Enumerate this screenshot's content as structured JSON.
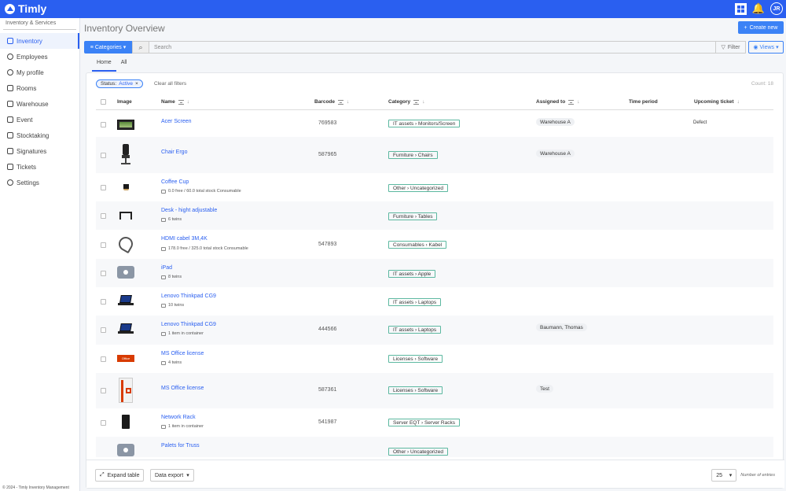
{
  "app": {
    "name": "Timly"
  },
  "header": {
    "avatar_initials": "JR"
  },
  "sidebar": {
    "section": "Inventory & Services",
    "items": [
      {
        "label": "Inventory"
      },
      {
        "label": "Employees"
      },
      {
        "label": "My profile"
      },
      {
        "label": "Rooms"
      },
      {
        "label": "Warehouse"
      },
      {
        "label": "Event"
      },
      {
        "label": "Stocktaking"
      },
      {
        "label": "Signatures"
      },
      {
        "label": "Tickets"
      },
      {
        "label": "Settings"
      }
    ],
    "footer": "© 2024 - Timly Inventory Management"
  },
  "page": {
    "title": "Inventory Overview",
    "create_label": "Create new"
  },
  "toolbar": {
    "categories": "Categories",
    "search_placeholder": "Search",
    "filter": "Filter",
    "views": "Views"
  },
  "tabs": [
    {
      "label": "Home"
    },
    {
      "label": "All"
    }
  ],
  "filters": {
    "status_label": "Status:",
    "status_value": "Active",
    "clear": "Clear all filters",
    "count": "Count: 18"
  },
  "columns": {
    "image": "Image",
    "name": "Name",
    "barcode": "Barcode",
    "category": "Category",
    "assigned": "Assigned to",
    "time": "Time period",
    "ticket": "Upcoming ticket"
  },
  "rows": [
    {
      "name": "Acer Screen",
      "sub": "",
      "barcode": "769583",
      "category": "IT assets › Monitors/Screen",
      "assigned": "Warehouse A",
      "ticket": "Defect"
    },
    {
      "name": "Chair Ergo",
      "sub": "",
      "barcode": "587965",
      "category": "Furniture › Chairs",
      "assigned": "Warehouse A",
      "ticket": ""
    },
    {
      "name": "Coffee Cup",
      "sub": "0.0 free / 60.0 total stock Consumable",
      "barcode": "",
      "category": "Other › Uncategorized",
      "assigned": "",
      "ticket": ""
    },
    {
      "name": "Desk - hight adjustable",
      "sub": "6 twins",
      "barcode": "",
      "category": "Furniture › Tables",
      "assigned": "",
      "ticket": ""
    },
    {
      "name": "HDMI cabel 3M,4K",
      "sub": "178.0 free / 325.0 total stock Consumable",
      "barcode": "547893",
      "category": "Consumables › Kabel",
      "assigned": "",
      "ticket": ""
    },
    {
      "name": "iPad",
      "sub": "8 twins",
      "barcode": "",
      "category": "IT assets › Apple",
      "assigned": "",
      "ticket": ""
    },
    {
      "name": "Lenovo Thinkpad CG9",
      "sub": "10 twins",
      "barcode": "",
      "category": "IT assets › Laptops",
      "assigned": "",
      "ticket": ""
    },
    {
      "name": "Lenovo Thinkpad CG9",
      "sub": "1 item in container",
      "barcode": "444566",
      "category": "IT assets › Laptops",
      "assigned": "Baumann, Thomas",
      "ticket": ""
    },
    {
      "name": "MS Office license",
      "sub": "4 twins",
      "barcode": "",
      "category": "Licenses › Software",
      "assigned": "",
      "ticket": ""
    },
    {
      "name": "MS Office license",
      "sub": "",
      "barcode": "587361",
      "category": "Licenses › Software",
      "assigned": "Test",
      "ticket": ""
    },
    {
      "name": "Network Rack",
      "sub": "1 item in container",
      "barcode": "541987",
      "category": "Server EQT › Server Racks",
      "assigned": "",
      "ticket": ""
    },
    {
      "name": "Palets for Truss",
      "sub": "",
      "barcode": "",
      "category": "Other › Uncategorized",
      "assigned": "",
      "ticket": ""
    }
  ],
  "thumb_texts": {
    "office_badge": "Office"
  },
  "footer": {
    "expand": "Expand table",
    "export": "Data export",
    "per_page": "25",
    "entries_label": "Number of entries"
  }
}
